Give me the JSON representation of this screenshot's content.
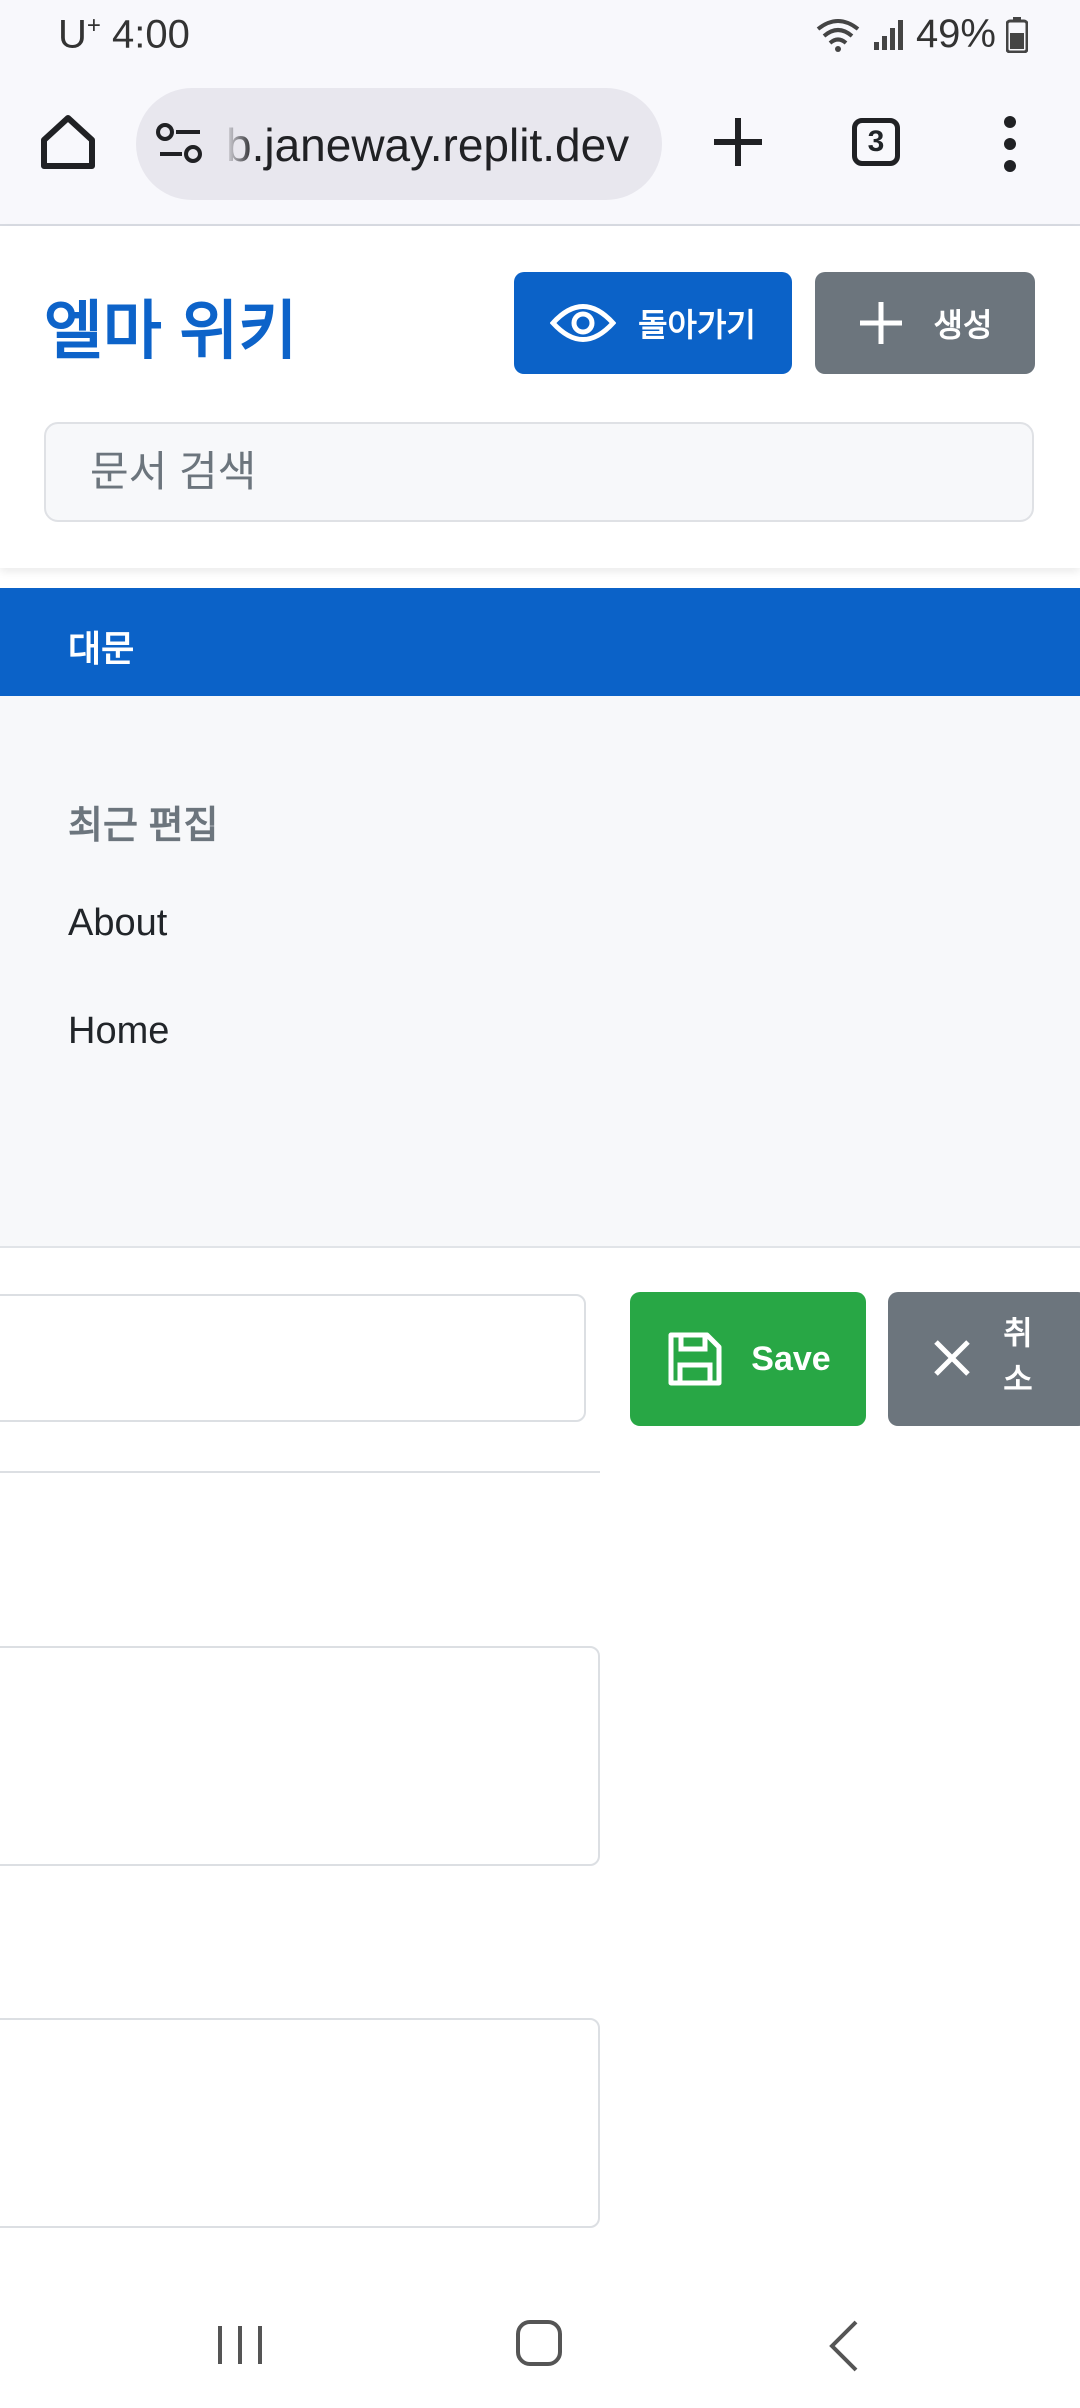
{
  "status_bar": {
    "carrier": "U",
    "carrier_sup": "+",
    "time": "4:00",
    "battery": "49%"
  },
  "browser": {
    "url": "b.janeway.replit.dev",
    "tab_count": "3"
  },
  "header": {
    "title": "엘마 위키",
    "back_button": "돌아가기",
    "create_button": "생성",
    "search_placeholder": "문서 검색"
  },
  "nav": {
    "main_label": "대문"
  },
  "sidebar": {
    "recent_heading": "최근 편집",
    "items": [
      {
        "label": "About"
      },
      {
        "label": "Home"
      }
    ]
  },
  "editor": {
    "save_button": "Save",
    "cancel_button": "취소"
  },
  "colors": {
    "primary": "#0b62c8",
    "secondary": "#6c757d",
    "success": "#28a745"
  }
}
